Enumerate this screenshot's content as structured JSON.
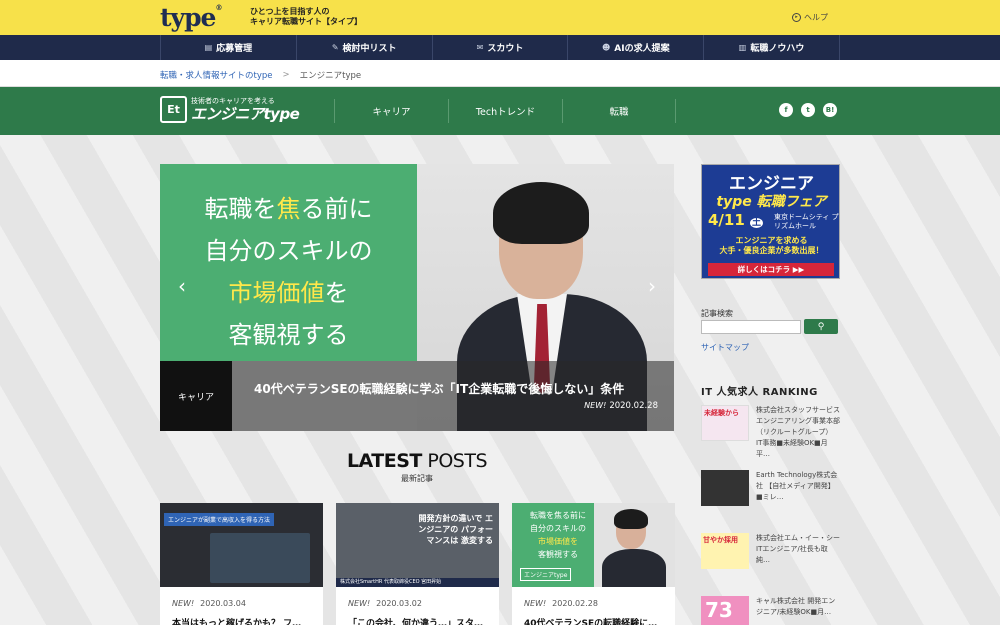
{
  "header": {
    "logo": "type",
    "logo_mark": "®",
    "tagline_line1": "ひとつ上を目指す人の",
    "tagline_line2": "キャリア転職サイト【タイプ】",
    "help_label": "ヘルプ"
  },
  "main_nav": [
    {
      "label": "応募管理",
      "icon": "document-icon"
    },
    {
      "label": "検討中リスト",
      "icon": "pencil-icon"
    },
    {
      "label": "スカウト",
      "icon": "mail-icon"
    },
    {
      "label": "AIの求人提案",
      "icon": "robot-icon"
    },
    {
      "label": "転職ノウハウ",
      "icon": "book-icon"
    }
  ],
  "breadcrumb": {
    "home": "転職・求人情報サイトのtype",
    "separator": ">",
    "current": "エンジニアtype"
  },
  "site": {
    "logo_box": "Et",
    "sub": "技術者のキャリアを考える",
    "name": "エンジニアtype"
  },
  "section_nav": [
    "キャリア",
    "Techトレンド",
    "転職"
  ],
  "social": {
    "facebook": "f",
    "twitter": "t",
    "hatena": "B!"
  },
  "hero": {
    "headline_line1": "転職を",
    "headline_hl1": "焦",
    "headline_line1b": "る前に",
    "headline_line2": "自分のスキルの",
    "headline_hl2": "市場価値",
    "headline_line3b": "を",
    "headline_line4": "客観視する",
    "category": "キャリア",
    "title": "40代ベテランSEの転職経験に学ぶ「IT企業転職で後悔しない」条件",
    "new": "NEW!",
    "date": "2020.02.28",
    "prev": "‹",
    "next": "›"
  },
  "latest": {
    "title_bold": "LATEST",
    "title_rest": " POSTS",
    "subtitle": "最新記事"
  },
  "posts": [
    {
      "thumb_tag": "エンジニアが副業で高収入を得る方法",
      "new": "NEW!",
      "date": "2020.03.04",
      "title": "本当はもっと稼げるかも？ フ…"
    },
    {
      "thumb_text": "開発方針の違いで エンジニアの パフォーマンスは 激変する",
      "thumb_bar": "株式会社SmartHR 代表取締役CEO 宮田昇始",
      "new": "NEW!",
      "date": "2020.03.02",
      "title": "「この会社、何か違う…」スタ…"
    },
    {
      "thumb_l1": "転職を焦る前に",
      "thumb_l2": "自分のスキルの",
      "thumb_l3": "市場価値を",
      "thumb_l4": "客観視する",
      "thumb_logo": "エンジニアtype",
      "new": "NEW!",
      "date": "2020.02.28",
      "title": "40代ベテランSEの転職経験に…"
    }
  ],
  "fair_banner": {
    "line1": "エンジニア",
    "line2": "type 転職フェア",
    "date": "4/11",
    "day": "土",
    "venue": "東京ドームシティ プリズムホール",
    "promo1": "エンジニアを求める",
    "promo2": "大手・優良企業が多数出展！",
    "button": "詳しくはコチラ ▶▶"
  },
  "search": {
    "label": "記事検索",
    "placeholder": "",
    "button_icon": "search-icon"
  },
  "sitemap": "サイトマップ",
  "ranking": {
    "title": "IT 人気求人 RANKING",
    "items": [
      {
        "thumb": "未経験から",
        "text": "株式会社スタッフサービス エンジニアリング事業本部（リクルートグループ） IT事務■未経験OK■月平…"
      },
      {
        "thumb": "",
        "text": "Earth Technology株式会社 【自社メディア開発】■ミレ…"
      },
      {
        "thumb": "甘やか採用",
        "text": "株式会社エム・イー・シー ITエンジニア/社長も取純…"
      },
      {
        "thumb": "73",
        "text": "キャル株式会社 開発エンジニア/未経験OK■月…"
      }
    ]
  }
}
